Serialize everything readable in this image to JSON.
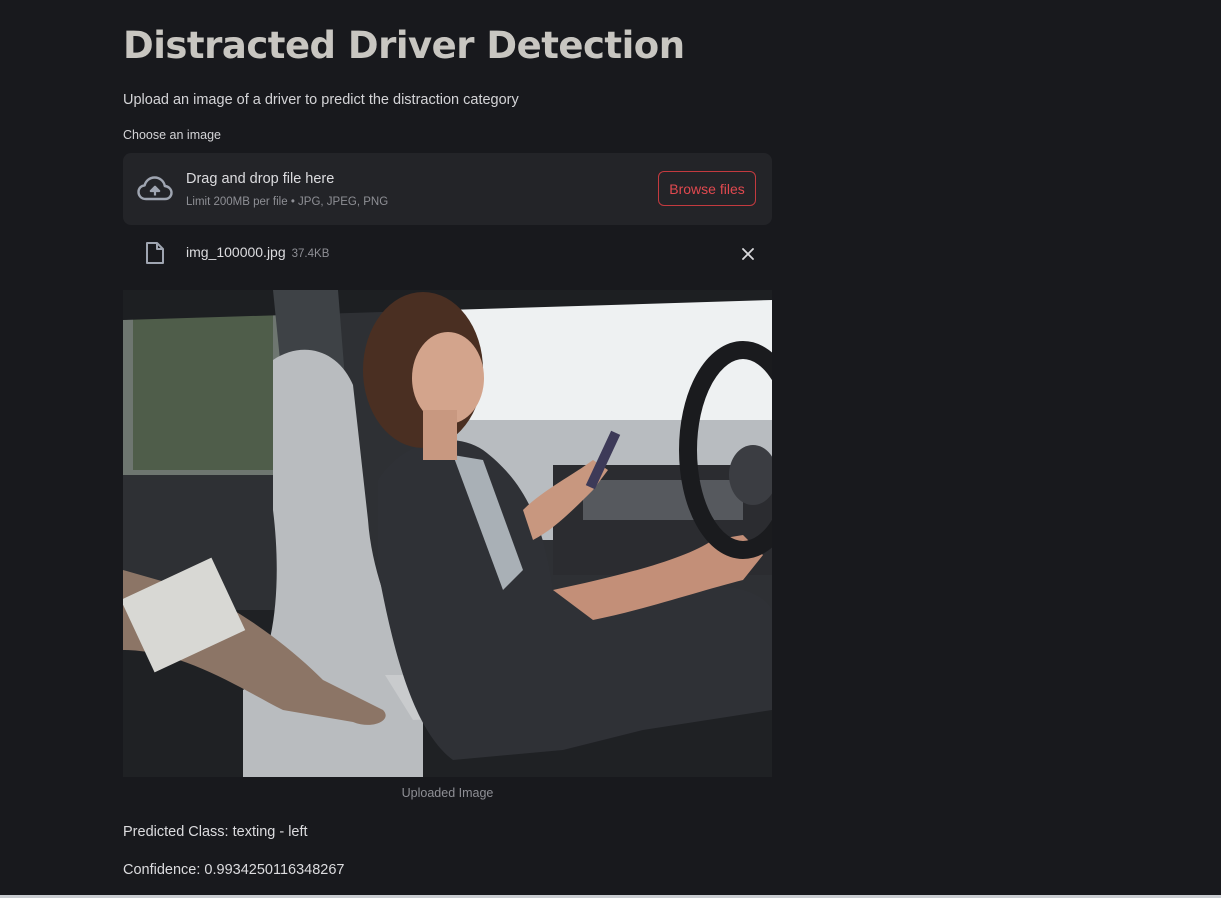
{
  "page": {
    "title": "Distracted Driver Detection",
    "subtitle": "Upload an image of a driver to predict the distraction category"
  },
  "uploader": {
    "label": "Choose an image",
    "drop_text": "Drag and drop file here",
    "limit_text": "Limit 200MB per file • JPG, JPEG, PNG",
    "browse_label": "Browse files",
    "upload_icon": "cloud-upload-icon"
  },
  "file": {
    "name": "img_100000.jpg",
    "size": "37.4KB",
    "file_icon": "file-icon",
    "remove_icon": "close-icon"
  },
  "image": {
    "caption": "Uploaded Image"
  },
  "results": {
    "predicted_class": "Predicted Class: texting - left",
    "confidence": "Confidence: 0.9934250116348267"
  },
  "colors": {
    "background": "#18191d",
    "accent": "#e0494f",
    "dropzone": "#232428"
  }
}
